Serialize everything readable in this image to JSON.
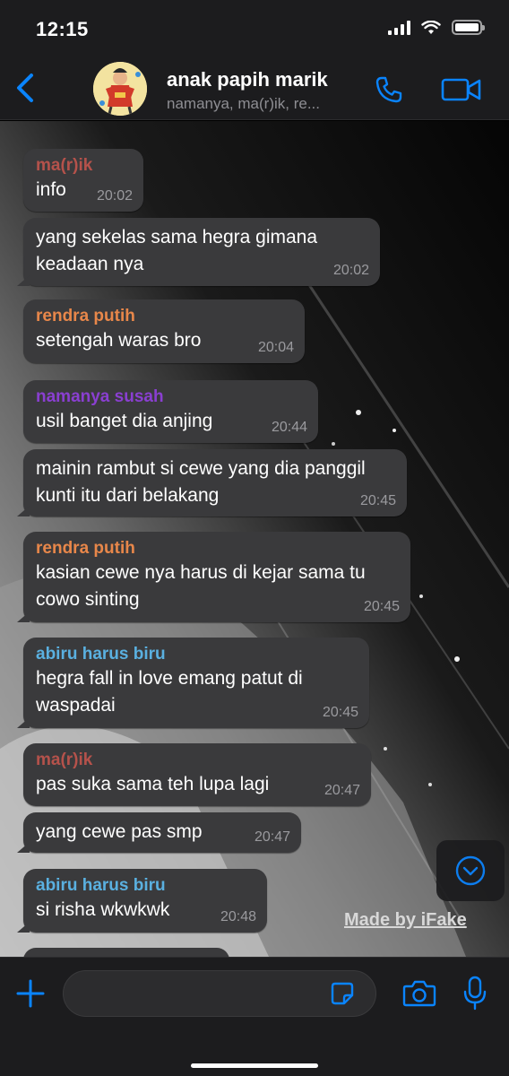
{
  "status_bar": {
    "time": "12:15"
  },
  "header": {
    "title": "anak papih marik",
    "subtitle": "namanya, ma(r)ik, re..."
  },
  "colors": {
    "accent": "#0a84ff",
    "bubble": "#3a3a3c",
    "sender_marik": "#b5524b",
    "sender_rendra": "#e8874a",
    "sender_namanya": "#8a3fd1",
    "sender_abiru": "#5ab0e0"
  },
  "messages": [
    {
      "sender": "ma(r)ik",
      "text": "info",
      "time": "20:02"
    },
    {
      "sender": "",
      "text": "yang sekelas sama hegra gimana keadaan nya",
      "time": "20:02"
    },
    {
      "sender": "rendra putih",
      "text": "setengah waras bro",
      "time": "20:04"
    },
    {
      "sender": "namanya susah",
      "text": "usil banget dia anjing",
      "time": "20:44"
    },
    {
      "sender": "",
      "text": "mainin rambut si cewe yang dia panggil kunti itu dari belakang",
      "time": "20:45"
    },
    {
      "sender": "rendra putih",
      "text": "kasian cewe nya harus di kejar sama tu cowo sinting",
      "time": "20:45"
    },
    {
      "sender": "abiru harus biru",
      "text": "hegra fall in love emang patut di waspadai",
      "time": "20:45"
    },
    {
      "sender": "ma(r)ik",
      "text": "pas suka sama teh lupa lagi",
      "time": "20:47"
    },
    {
      "sender": "",
      "text": "yang cewe pas smp",
      "time": "20:47"
    },
    {
      "sender": "abiru harus biru",
      "text": "si risha wkwkwk",
      "time": "20:48"
    }
  ],
  "watermark": "Made by iFake",
  "input": {
    "placeholder": ""
  },
  "icons": {
    "back": "chevron-left-icon",
    "call": "phone-icon",
    "video": "video-camera-icon",
    "scroll": "chevron-down-circle-icon",
    "add": "plus-icon",
    "sticker": "sticker-icon",
    "camera": "camera-icon",
    "mic": "microphone-icon"
  }
}
